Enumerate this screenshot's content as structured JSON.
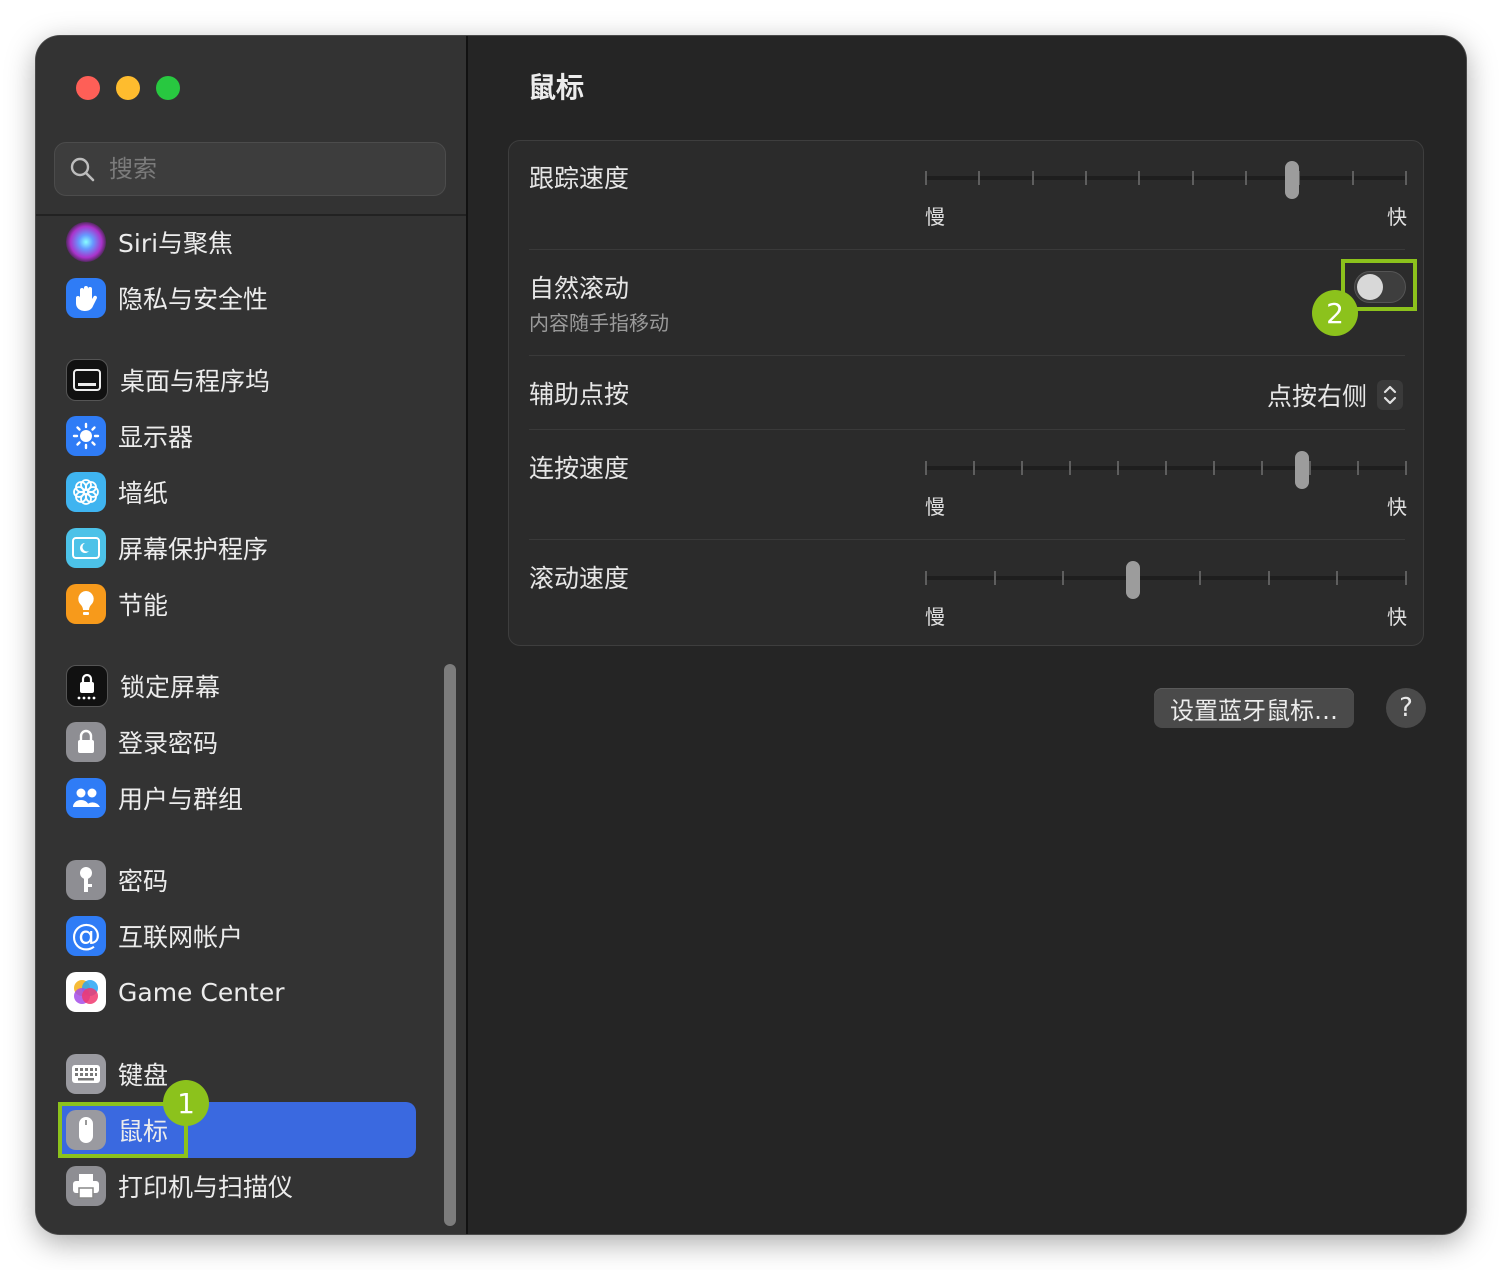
{
  "window": {
    "traffic_lights": [
      "close",
      "minimize",
      "zoom"
    ]
  },
  "search": {
    "placeholder": "搜索"
  },
  "sidebar": {
    "items": [
      {
        "label": "Siri与聚焦",
        "icon": "siri-icon"
      },
      {
        "label": "隐私与安全性",
        "icon": "hand-icon"
      },
      {
        "label": "桌面与程序坞",
        "icon": "dock-icon"
      },
      {
        "label": "显示器",
        "icon": "sun-icon"
      },
      {
        "label": "墙纸",
        "icon": "flower-icon"
      },
      {
        "label": "屏幕保护程序",
        "icon": "screensaver-icon"
      },
      {
        "label": "节能",
        "icon": "lightbulb-icon"
      },
      {
        "label": "锁定屏幕",
        "icon": "lock-screen-icon"
      },
      {
        "label": "登录密码",
        "icon": "lock-icon"
      },
      {
        "label": "用户与群组",
        "icon": "users-icon"
      },
      {
        "label": "密码",
        "icon": "key-icon"
      },
      {
        "label": "互联网帐户",
        "icon": "at-icon"
      },
      {
        "label": "Game Center",
        "icon": "game-center-icon"
      },
      {
        "label": "键盘",
        "icon": "keyboard-icon"
      },
      {
        "label": "鼠标",
        "icon": "mouse-icon",
        "selected": true
      },
      {
        "label": "打印机与扫描仪",
        "icon": "printer-icon"
      }
    ]
  },
  "main": {
    "title": "鼠标",
    "tracking": {
      "label": "跟踪速度",
      "min": "慢",
      "max": "快",
      "value": 0.77,
      "ticks": 10
    },
    "natural_scroll": {
      "label": "自然滚动",
      "sub": "内容随手指移动",
      "on": false
    },
    "secondary_click": {
      "label": "辅助点按",
      "value": "点按右侧"
    },
    "double_click": {
      "label": "连按速度",
      "min": "慢",
      "max": "快",
      "value": 0.79,
      "ticks": 11
    },
    "scroll_speed": {
      "label": "滚动速度",
      "min": "慢",
      "max": "快",
      "value": 0.43,
      "ticks": 8
    },
    "bt_button": "设置蓝牙鼠标…",
    "help": "?"
  },
  "annotations": {
    "badge1": "1",
    "badge2": "2",
    "color": "#8cc21c"
  },
  "colors": {
    "accent": "#3a69e0"
  }
}
